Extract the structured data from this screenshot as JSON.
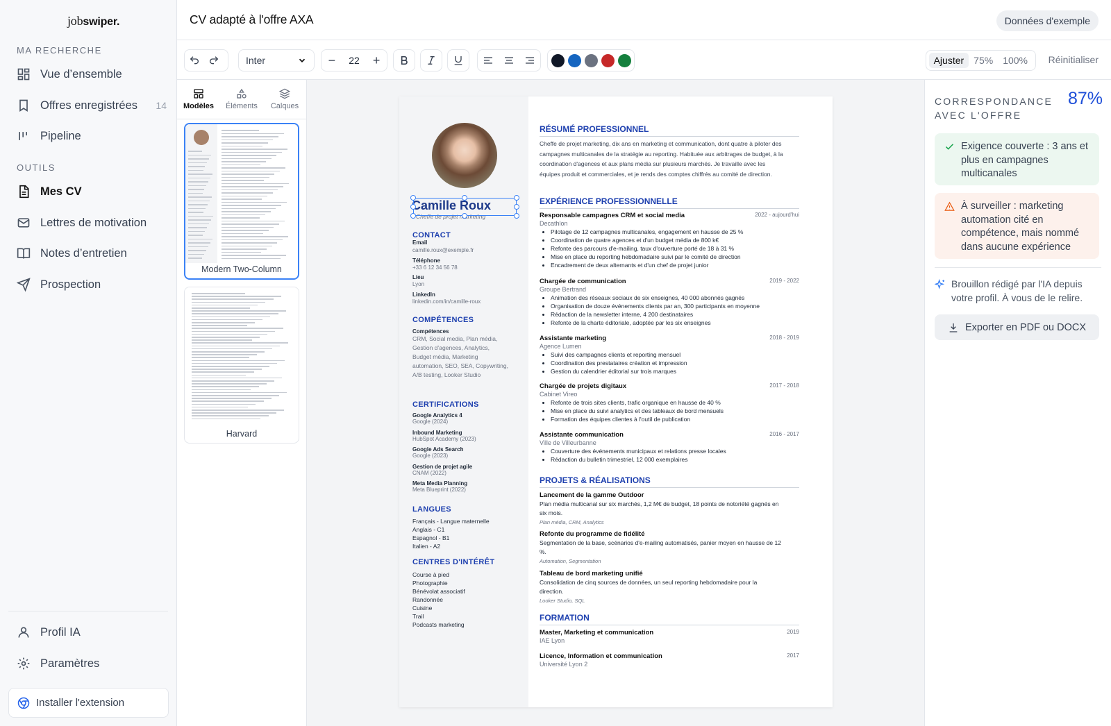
{
  "app": {
    "logo_prefix": "job",
    "logo_suffix": "swiper."
  },
  "sidebar": {
    "section_search": "MA RECHERCHE",
    "section_tools": "OUTILS",
    "items": [
      {
        "label": "Vue d’ensemble",
        "icon": "grid-icon"
      },
      {
        "label": "Offres enregistrées",
        "icon": "bookmark-icon",
        "count": "14"
      },
      {
        "label": "Pipeline",
        "icon": "pipeline-icon"
      },
      {
        "label": "Mes CV",
        "icon": "document-icon",
        "active": true
      },
      {
        "label": "Lettres de motivation",
        "icon": "mail-icon"
      },
      {
        "label": "Notes d’entretien",
        "icon": "book-icon"
      },
      {
        "label": "Prospection",
        "icon": "send-icon"
      }
    ],
    "bottom_items": [
      {
        "label": "Profil IA",
        "icon": "user-icon"
      },
      {
        "label": "Paramètres",
        "icon": "gear-icon"
      }
    ],
    "install_label": "Installer l'extension"
  },
  "header": {
    "title": "CV adapté à l'offre AXA",
    "sample_label": "Données d'exemple"
  },
  "toolbar": {
    "font": "Inter",
    "font_size": "22",
    "colors": [
      "#111827",
      "#1565c0",
      "#6b7280",
      "#c62828",
      "#15803d"
    ],
    "zoom_options": [
      "Ajuster",
      "75%",
      "100%"
    ],
    "zoom_selected": "Ajuster",
    "reset_label": "Réinitialiser"
  },
  "left_panel": {
    "tabs": [
      "Modèles",
      "Éléments",
      "Calques"
    ],
    "active_tab": "Modèles",
    "templates": [
      {
        "name": "Modern Two-Column",
        "selected": true
      },
      {
        "name": "Harvard",
        "selected": false
      }
    ]
  },
  "cv": {
    "name": "Camille Roux",
    "role": "Cheffe de projet marketing",
    "contact_heading": "CONTACT",
    "contact": [
      {
        "label": "Email",
        "value": "camille.roux@exemple.fr"
      },
      {
        "label": "Téléphone",
        "value": "+33 6 12 34 56 78"
      },
      {
        "label": "Lieu",
        "value": "Lyon"
      },
      {
        "label": "LinkedIn",
        "value": "linkedin.com/in/camille-roux"
      }
    ],
    "skills_heading": "COMPÉTENCES",
    "skills_label": "Compétences",
    "skills_lines": [
      "CRM, Social media, Plan média,",
      "Gestion d’agences, Analytics,",
      "Budget média, Marketing",
      "automation, SEO, SEA, Copywriting,",
      "A/B testing, Looker Studio"
    ],
    "certs_heading": "CERTIFICATIONS",
    "certs": [
      {
        "name": "Google Analytics 4",
        "org": "Google (2024)"
      },
      {
        "name": "Inbound Marketing",
        "org": "HubSpot Academy (2023)"
      },
      {
        "name": "Google Ads Search",
        "org": "Google (2023)"
      },
      {
        "name": "Gestion de projet agile",
        "org": "CNAM (2022)"
      },
      {
        "name": "Meta Media Planning",
        "org": "Meta Blueprint (2022)"
      }
    ],
    "languages_heading": "LANGUES",
    "languages": [
      "Français - Langue maternelle",
      "Anglais - C1",
      "Espagnol - B1",
      "Italien - A2"
    ],
    "interests_heading": "CENTRES D'INTÉRÊT",
    "interests": [
      "Course à pied",
      "Photographie",
      "Bénévolat associatif",
      "Randonnée",
      "Cuisine",
      "Trail",
      "Podcasts marketing"
    ],
    "summary_heading": "RÉSUMÉ PROFESSIONNEL",
    "summary_lines": [
      "Cheffe de projet marketing, dix ans en marketing et communication, dont quatre à piloter des",
      "campagnes multicanales de la stratégie au reporting. Habituée aux arbitrages de budget, à la",
      "coordination d'agences et aux plans média sur plusieurs marchés. Je travaille avec les",
      "équipes produit et commerciales, et je rends des comptes chiffrés au comité de direction."
    ],
    "experience_heading": "EXPÉRIENCE PROFESSIONNELLE",
    "jobs": [
      {
        "title": "Responsable campagnes CRM et social media",
        "company": "Decathlon",
        "dates": "2022 - aujourd'hui",
        "bullets": [
          "Pilotage de 12 campagnes multicanales, engagement en hausse de 25 %",
          "Coordination de quatre agences et d'un budget média de 800 k€",
          "Refonte des parcours d'e-mailing, taux d'ouverture porté de 18 à 31 %",
          "Mise en place du reporting hebdomadaire suivi par le comité de direction",
          "Encadrement de deux alternants et d'un chef de projet junior"
        ]
      },
      {
        "title": "Chargée de communication",
        "company": "Groupe Bertrand",
        "dates": "2019 - 2022",
        "bullets": [
          "Animation des réseaux sociaux de six enseignes, 40 000 abonnés gagnés",
          "Organisation de douze événements clients par an, 300 participants en moyenne",
          "Rédaction de la newsletter interne, 4 200 destinataires",
          "Refonte de la charte éditoriale, adoptée par les six enseignes"
        ]
      },
      {
        "title": "Assistante marketing",
        "company": "Agence Lumen",
        "dates": "2018 - 2019",
        "bullets": [
          "Suivi des campagnes clients et reporting mensuel",
          "Coordination des prestataires création et impression",
          "Gestion du calendrier éditorial sur trois marques"
        ]
      },
      {
        "title": "Chargée de projets digitaux",
        "company": "Cabinet Vireo",
        "dates": "2017 - 2018",
        "bullets": [
          "Refonte de trois sites clients, trafic organique en hausse de 40 %",
          "Mise en place du suivi analytics et des tableaux de bord mensuels",
          "Formation des équipes clientes à l'outil de publication"
        ]
      },
      {
        "title": "Assistante communication",
        "company": "Ville de Villeurbanne",
        "dates": "2016 - 2017",
        "bullets": [
          "Couverture des événements municipaux et relations presse locales",
          "Rédaction du bulletin trimestriel, 12 000 exemplaires"
        ]
      }
    ],
    "projects_heading": "PROJETS & RÉALISATIONS",
    "projects": [
      {
        "title": "Lancement de la gamme Outdoor",
        "lines": [
          "Plan média multicanal sur six marchés, 1,2 M€ de budget, 18 points de notoriété gagnés en",
          "six mois."
        ],
        "tags": "Plan média, CRM, Analytics"
      },
      {
        "title": "Refonte du programme de fidélité",
        "lines": [
          "Segmentation de la base, scénarios d'e-mailing automatisés, panier moyen en hausse de 12",
          "%."
        ],
        "tags": "Automation, Segmentation"
      },
      {
        "title": "Tableau de bord marketing unifié",
        "lines": [
          "Consolidation de cinq sources de données, un seul reporting hebdomadaire pour la",
          "direction."
        ],
        "tags": "Looker Studio, SQL"
      }
    ],
    "education_heading": "FORMATION",
    "education": [
      {
        "degree": "Master, Marketing et communication",
        "school": "IAE Lyon",
        "year": "2019"
      },
      {
        "degree": "Licence, Information et communication",
        "school": "Université Lyon 2",
        "year": "2017"
      }
    ]
  },
  "right_panel": {
    "match_label_1": "CORRESPONDANCE",
    "match_label_2": "AVEC L'OFFRE",
    "match_value": "87%",
    "match_pct": 0.87,
    "note_ok": "Exigence couverte : 3 ans et plus en campagnes multicanales",
    "note_warn": "À surveiller : marketing automation cité en compétence, mais nommé dans aucune expérience",
    "ai_note": "Brouillon rédigé par l'IA depuis votre profil. À vous de le relire.",
    "export_label": "Exporter en PDF ou DOCX"
  }
}
